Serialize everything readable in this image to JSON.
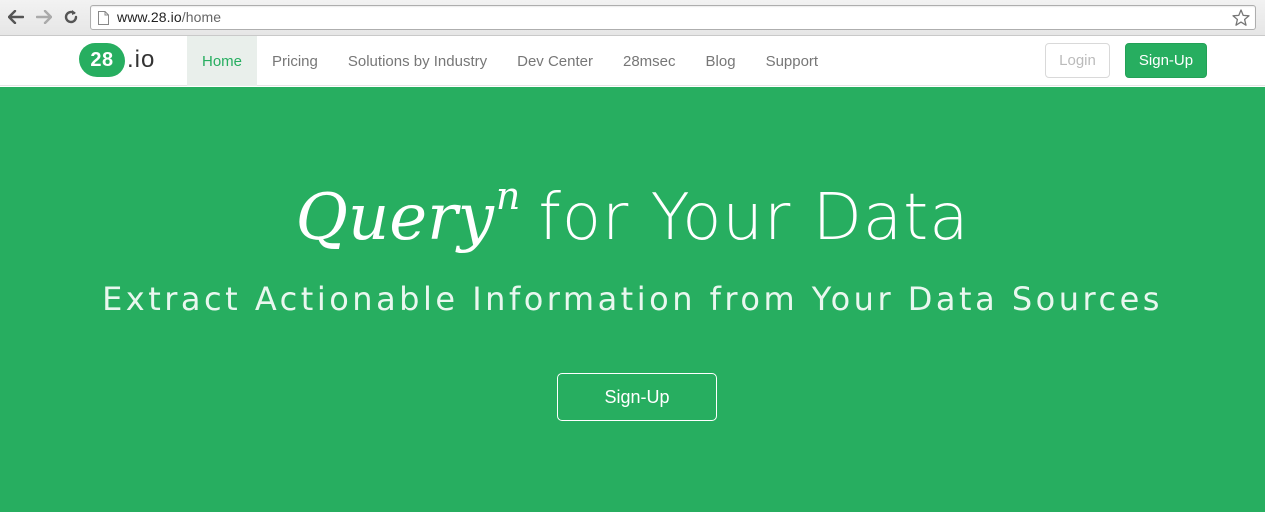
{
  "browser": {
    "url_host": "www.28.io",
    "url_path": "/home",
    "icons": [
      "back-arrow-icon",
      "forward-arrow-icon",
      "reload-icon",
      "page-icon",
      "bookmark-star-icon"
    ]
  },
  "navbar": {
    "logo_badge": "28",
    "logo_suffix": ".io",
    "links": [
      "Home",
      "Pricing",
      "Solutions by Industry",
      "Dev Center",
      "28msec",
      "Blog",
      "Support"
    ],
    "active_link": "Home",
    "login_label": "Login",
    "signup_label": "Sign-Up"
  },
  "hero": {
    "title_word": "Query",
    "title_superscript": "n",
    "title_rest": "for Your Data",
    "subtitle": "Extract Actionable Information from Your Data Sources",
    "cta_label": "Sign-Up"
  },
  "colors": {
    "brand_green": "#27ae60",
    "active_nav_bg": "#e9efeb"
  }
}
